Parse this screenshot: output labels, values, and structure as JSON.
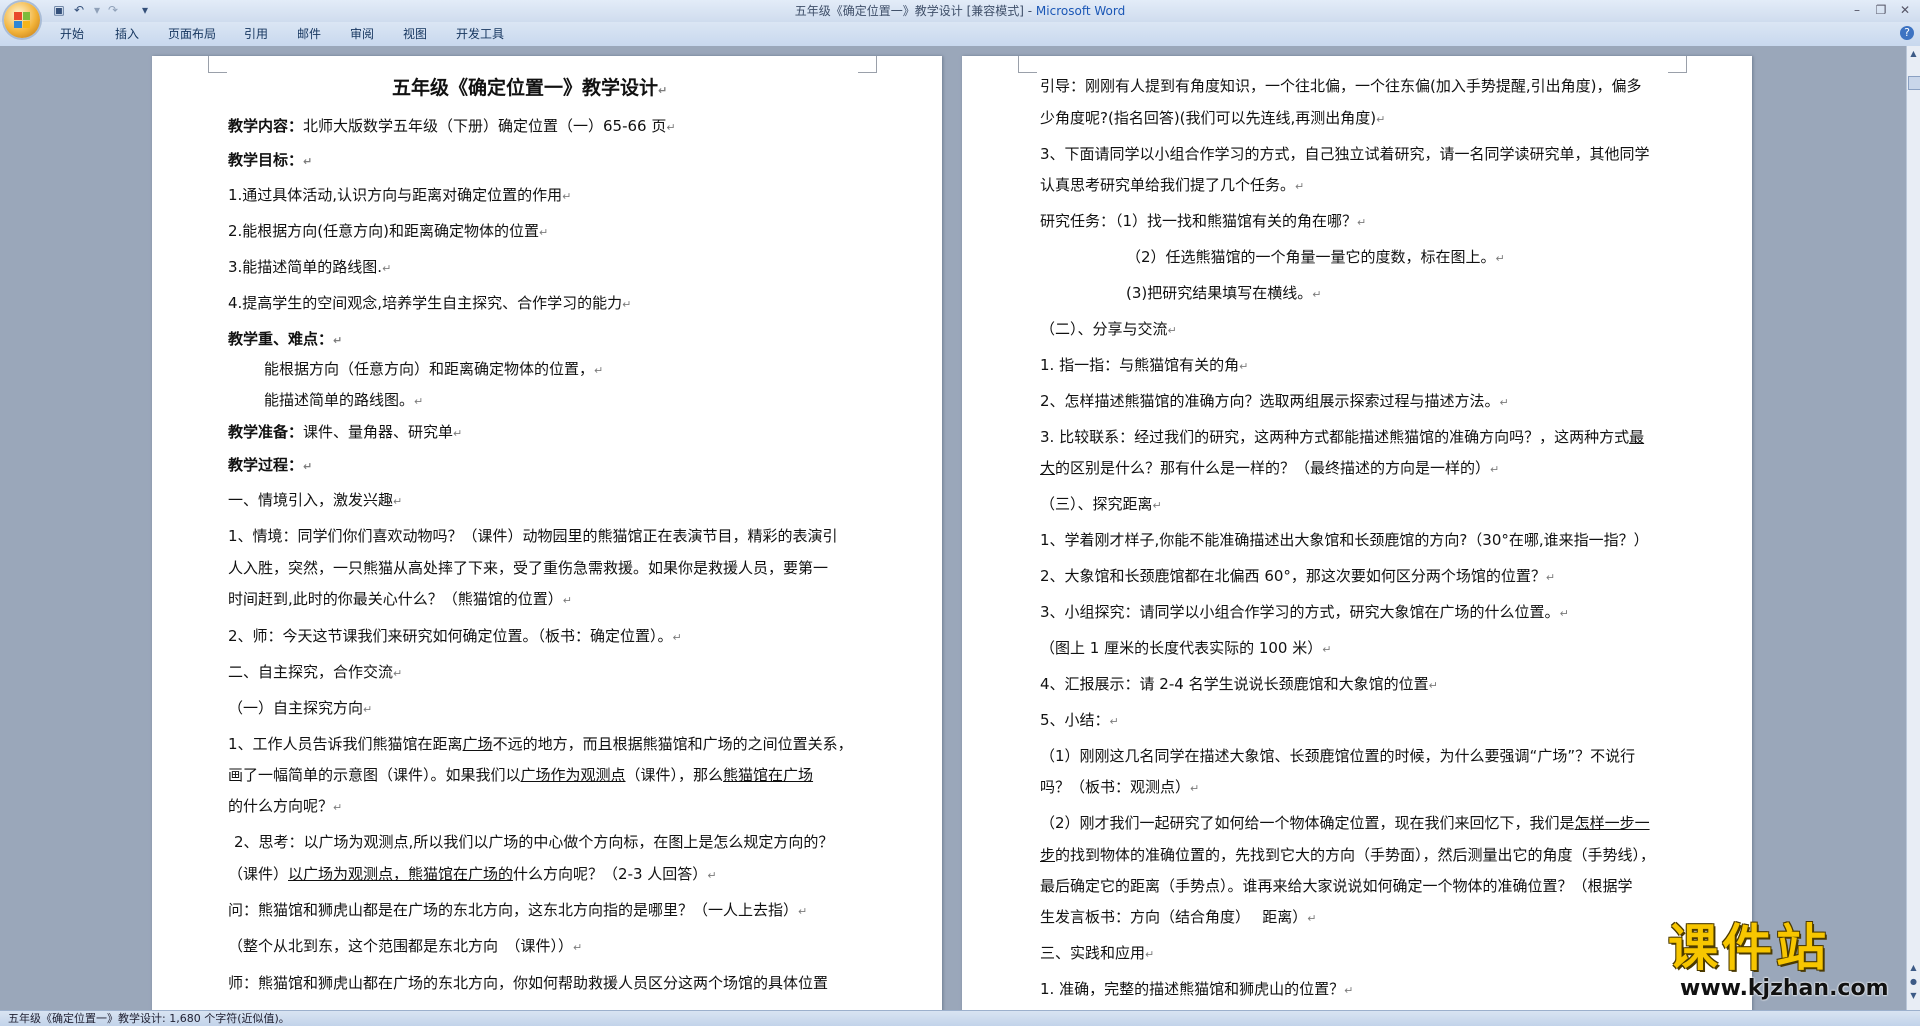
{
  "window": {
    "title": "五年级《确定位置一》教学设计 [兼容模式] - ",
    "title_brand": "Microsoft Word"
  },
  "quick_access": {
    "save_icon": "save-icon",
    "undo_icon": "undo-icon",
    "redo_icon": "redo-icon",
    "customize_icon": "dropdown-icon"
  },
  "ribbon_tabs": [
    "开始",
    "插入",
    "页面布局",
    "引用",
    "邮件",
    "审阅",
    "视图",
    "开发工具"
  ],
  "colors": {
    "title_brand": "#1b57b6",
    "watermark": "#f7c600",
    "page": "#ffffff",
    "workspace": "#9aa7ba"
  },
  "page1": {
    "title": "五年级《确定位置一》教学设计",
    "p1_label": "教学内容：",
    "p1_text": "北师大版数学五年级（下册）确定位置（一）65-66 页",
    "p2_label": "教学目标：",
    "p3": "1.通过具体活动,认识方向与距离对确定位置的作用",
    "p4": "2.能根据方向(任意方向)和距离确定物体的位置",
    "p5": "3.能描述简单的路线图.",
    "p6": "4.提高学生的空间观念,培养学生自主探究、合作学习的能力",
    "p7_label": "教学重、难点：",
    "p8": "能根据方向（任意方向）和距离确定物体的位置，",
    "p9": "能描述简单的路线图。",
    "p10_label": "教学准备：",
    "p10_text": "课件、量角器、研究单",
    "p11_label": "教学过程：",
    "p12": "一、情境引入，激发兴趣",
    "p13a": "1、情境：同学们你们喜欢动物吗？（课件）动物园里的熊猫馆正在表演节目，精彩的表演引",
    "p13b": "人入胜，突然，一只熊猫从高处摔了下来，受了重伤急需救援。如果你是救援人员，要第一",
    "p13c": "时间赶到,此时的你最关心什么？（熊猫馆的位置）",
    "p14": "2、师：今天这节课我们来研究如何确定位置。（板书：确定位置）。",
    "p15": "二、自主探究，合作交流",
    "p16": "（一）自主探究方向",
    "p17a_1": "1、工作人员告诉我们熊猫馆在距离",
    "p17a_u": "广场",
    "p17a_2": "不远的地方，而且根据熊猫馆和广场的之间位置关系，",
    "p17b_1": "画了一幅简单的示意图（课件）。如果我们以",
    "p17b_u1": "广场作为观测点",
    "p17b_2": "（课件），那么",
    "p17b_u2": "熊猫馆在广场",
    "p17c": "的什么方向呢？",
    "p18a": "2、思考：以广场为观测点,所以我们以广场的中心做个方向标，在图上是怎么规定方向的？",
    "p18b_1": "（课件）",
    "p18b_u": "以广场为观测点，熊猫馆在广场的",
    "p18b_2": "什么方向呢？（2-3 人回答）",
    "p19": "问：熊猫馆和狮虎山都是在广场的东北方向，这东北方向指的是哪里？（一人上去指）",
    "p20": "（整个从北到东，这个范围都是东北方向　（课件））",
    "p21": "师：熊猫馆和狮虎山都在广场的东北方向，你如何帮助救援人员区分这两个场馆的具体位置"
  },
  "page2": {
    "p1a": "引导：刚刚有人提到有角度知识，一个往北偏，一个往东偏(加入手势提醒,引出角度)，偏多",
    "p1b": "少角度呢?(指名回答)(我们可以先连线,再测出角度)",
    "p2a": "3、下面请同学以小组合作学习的方式，自己独立试着研究，请一名同学读研究单，其他同学",
    "p2b": "认真思考研究单给我们提了几个任务。",
    "p3": "研究任务：（1）找一找和熊猫馆有关的角在哪？",
    "p4": "（2）任选熊猫馆的一个角量一量它的度数，标在图上。",
    "p5": "(3)把研究结果填写在横线。",
    "p6": "（二）、分享与交流",
    "p7": "1. 指一指：与熊猫馆有关的角",
    "p8": "2、怎样描述熊猫馆的准确方向？选取两组展示探索过程与描述方法。",
    "p9a_1": "3. 比较联系：经过我们的研究，这两种方式都能描述熊猫馆的准确方向吗？，这两种方式",
    "p9a_u": "最",
    "p9b_u": "大",
    "p9b_2": "的区别是什么？那有什么是一样的？（最终描述的方向是一样的）",
    "p10": "（三）、探究距离",
    "p11": "1、学着刚才样子,你能不能准确描述出大象馆和长颈鹿馆的方向?（30°在哪,谁来指一指？）",
    "p12": "2、大象馆和长颈鹿馆都在北偏西 60°，那这次要如何区分两个场馆的位置？",
    "p13": "3、小组探究：请同学以小组合作学习的方式，研究大象馆在广场的什么位置。",
    "p14": "（图上 1 厘米的长度代表实际的 100 米）",
    "p15": "4、汇报展示：请 2-4 名学生说说长颈鹿馆和大象馆的位置",
    "p16": "5、小结：",
    "p17a": "（1）刚刚这几名同学在描述大象馆、长颈鹿馆位置的时候，为什么要强调“广场”？不说行",
    "p17b": "吗？（板书：观测点）",
    "p18a_1": "（2）刚才我们一起研究了如何给一个物体确定位置，现在我们来回忆下，我们是",
    "p18a_u": "怎样一步一",
    "p18b_u": "步",
    "p18b_2": "的找到物体的准确位置的，先找到它大的方向（手势面），然后测量出它的角度（手势线），",
    "p18c": "最后确定它的距离（手势点）。谁再来给大家说说如何确定一个物体的准确位置？（根据学",
    "p18d": "生发言板书：方向（结合角度）　 距离）",
    "p19": "三、实践和应用",
    "p20": "1. 准确，完整的描述熊猫馆和狮虎山的位置？"
  },
  "status": {
    "text": "五年级《确定位置一》教学设计: 1,680 个字符(近似值)。"
  },
  "watermark": {
    "text": "课件站",
    "url": "www.kjzhan.com"
  }
}
